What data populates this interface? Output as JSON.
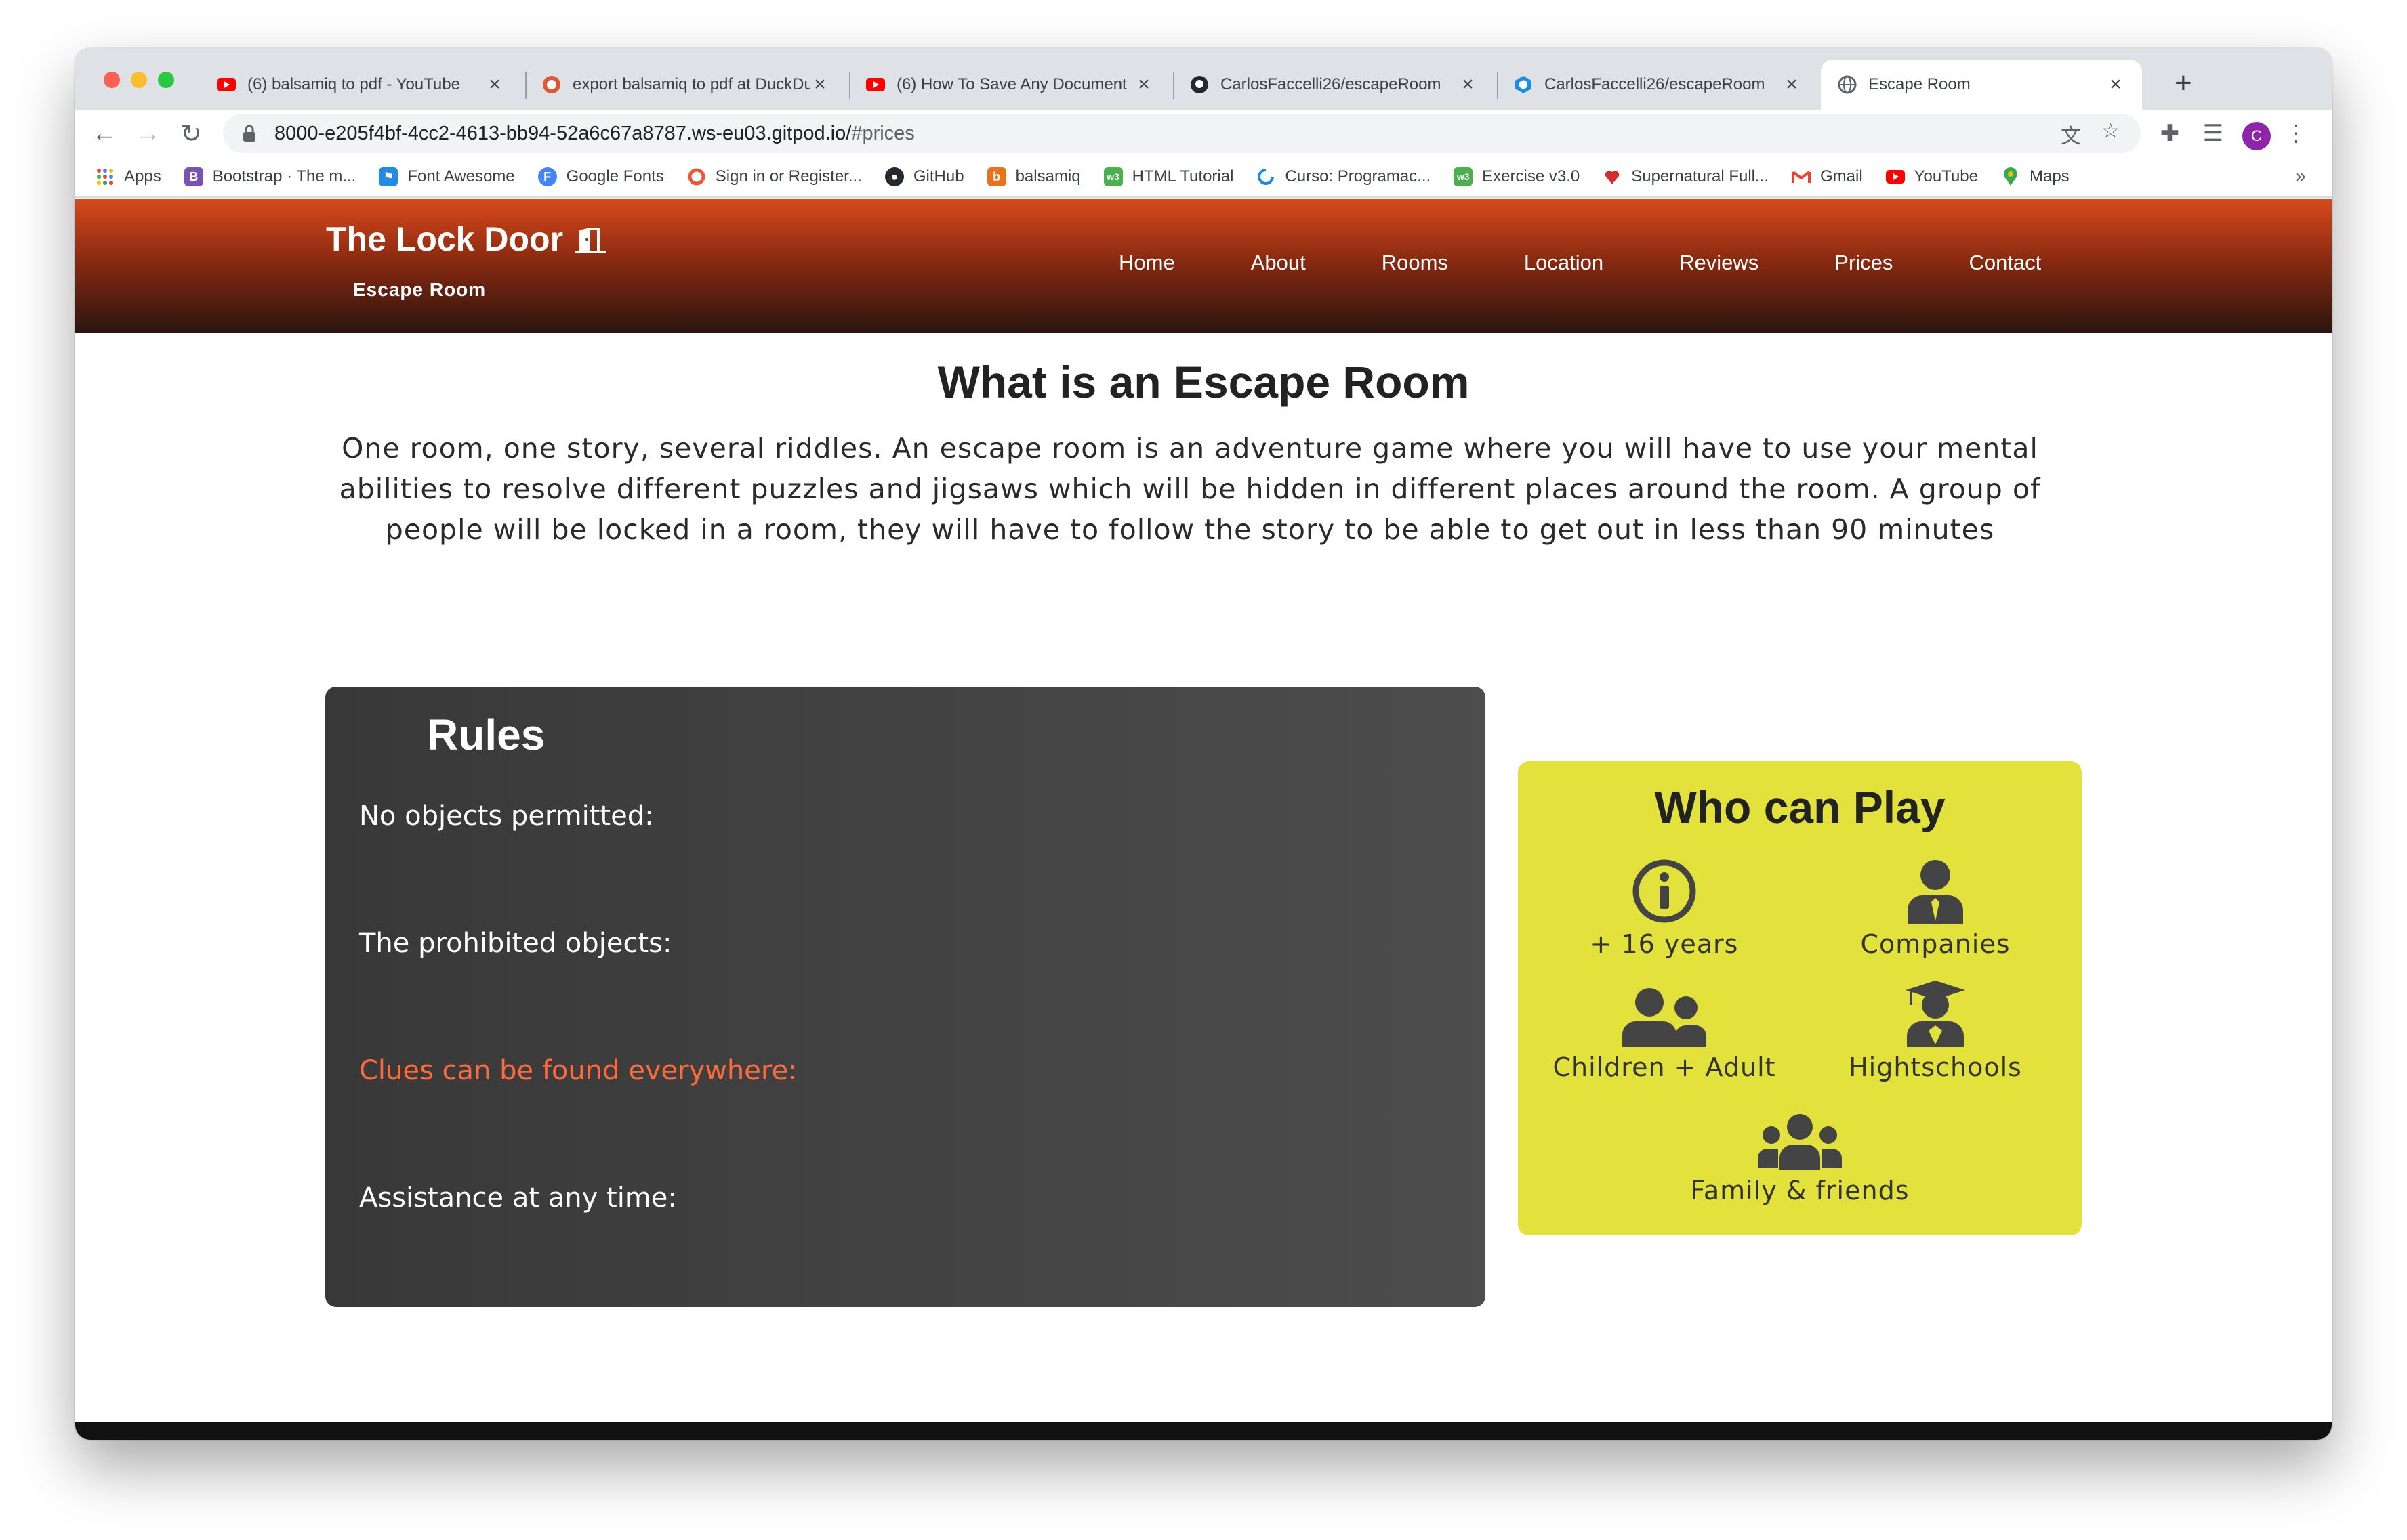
{
  "browser": {
    "tabs": [
      {
        "title": "(6) balsamiq to pdf - YouTube",
        "icon": "youtube-icon"
      },
      {
        "title": "export balsamiq to pdf at DuckDuckGo",
        "icon": "duckduckgo-icon"
      },
      {
        "title": "(6) How To Save Any Document",
        "icon": "youtube-icon"
      },
      {
        "title": "CarlosFaccelli26/escapeRoom",
        "icon": "github-icon"
      },
      {
        "title": "CarlosFaccelli26/escapeRoom",
        "icon": "gitpod-icon"
      },
      {
        "title": "Escape Room",
        "icon": "globe-icon",
        "active": true
      }
    ],
    "url_main": "8000-e205f4bf-4cc2-4613-bb94-52a6c67a8787.ws-eu03.gitpod.io/",
    "url_hash": "#prices",
    "profile_initial": "C",
    "bookmarks": [
      {
        "label": "Apps",
        "icon": "apps-grid-icon",
        "color": "#ea4335"
      },
      {
        "label": "Bootstrap · The m...",
        "icon": "bootstrap-icon",
        "color": "#7952b3"
      },
      {
        "label": "Font Awesome",
        "icon": "font-awesome-icon",
        "color": "#228ae6"
      },
      {
        "label": "Google Fonts",
        "icon": "google-fonts-icon",
        "color": "#4285f4"
      },
      {
        "label": "Sign in or Register...",
        "icon": "circle-icon",
        "color": "#f05537"
      },
      {
        "label": "GitHub",
        "icon": "github-icon",
        "color": "#24292e"
      },
      {
        "label": "balsamiq",
        "icon": "balsamiq-icon",
        "color": "#e8731c"
      },
      {
        "label": "HTML Tutorial",
        "icon": "w3schools-icon",
        "color": "#4caf50"
      },
      {
        "label": "Curso: Programac...",
        "icon": "loading-icon",
        "color": "#1e88e5"
      },
      {
        "label": "Exercise v3.0",
        "icon": "w3schools-icon",
        "color": "#4caf50"
      },
      {
        "label": "Supernatural Full...",
        "icon": "heart-icon",
        "color": "#d32f2f"
      },
      {
        "label": "Gmail",
        "icon": "gmail-icon",
        "color": "#ea4335"
      },
      {
        "label": "YouTube",
        "icon": "youtube-icon",
        "color": "#ff0000"
      },
      {
        "label": "Maps",
        "icon": "maps-icon",
        "color": "#34a853"
      }
    ]
  },
  "site": {
    "brand_title": "The Lock Door",
    "brand_subtitle": "Escape Room",
    "nav": [
      "Home",
      "About",
      "Rooms",
      "Location",
      "Reviews",
      "Prices",
      "Contact"
    ],
    "intro_title": "What is an Escape Room",
    "intro_text": "One room, one story, several riddles. An escape room is an adventure game where you will have to use your mental abilities to resolve different puzzles and jigsaws which will be hidden in different places around the room. A group of people will be locked in a room, they will have to follow the story to be able to get out in less than 90 minutes",
    "rules": {
      "title": "Rules",
      "items": [
        "No objects permitted:",
        "The prohibited objects:",
        "Clues can be found everywhere:",
        "Assistance at any time:"
      ]
    },
    "who": {
      "title": "Who can Play",
      "items": [
        {
          "label": "+ 16 years",
          "icon": "info-circle-icon"
        },
        {
          "label": "Companies",
          "icon": "user-tie-icon"
        },
        {
          "label": "Children + Adult",
          "icon": "user-friends-icon"
        },
        {
          "label": "Hightschools",
          "icon": "user-graduate-icon"
        },
        {
          "label": "Family & friends",
          "icon": "users-icon"
        }
      ]
    }
  },
  "colors": {
    "header_top": "#d9491c",
    "header_bottom": "#2a140e",
    "rules_bg": "#404040",
    "rules_highlight": "#ff6a3d",
    "who_bg": "#e3e23d"
  }
}
